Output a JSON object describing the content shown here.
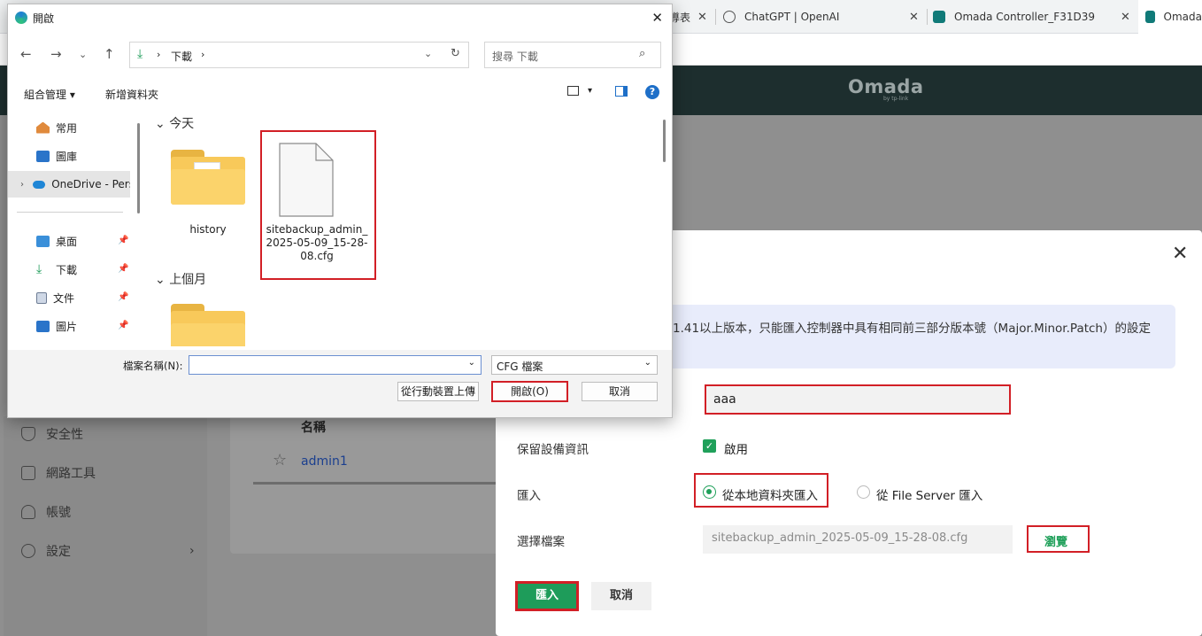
{
  "browser": {
    "tabs": [
      {
        "label": "導表",
        "favicon": "sheet-icon"
      },
      {
        "label": "ChatGPT | OpenAI",
        "favicon": "openai-icon"
      },
      {
        "label": "Omada Controller_F31D39",
        "favicon": "omada-icon"
      },
      {
        "label": "Omada",
        "favicon": "omada-icon"
      }
    ]
  },
  "omada": {
    "logo": "Omada",
    "logo_sub": "by tp-link",
    "nav": [
      {
        "label": "安全性",
        "icon": "shield-icon"
      },
      {
        "label": "網路工具",
        "icon": "toolbox-icon"
      },
      {
        "label": "帳號",
        "icon": "user-icon"
      },
      {
        "label": "設定",
        "icon": "gear-icon"
      }
    ],
    "table": {
      "header": "名稱",
      "rows": [
        "admin1"
      ]
    }
  },
  "import_modal": {
    "notice": "1.41以上版本，只能匯入控制器中具有相同前三部分版本號（Major.Minor.Patch）的設定",
    "name_value": "aaa",
    "keep_device_label": "保留設備資訊",
    "keep_device_option": "啟用",
    "import_label": "匯入",
    "radio_local": "從本地資料夾匯入",
    "radio_server": "從 File Server 匯入",
    "choose_file_label": "選擇檔案",
    "file_value": "sitebackup_admin_2025-05-09_15-28-08.cfg",
    "browse": "瀏覽",
    "import_button": "匯入",
    "cancel_button": "取消"
  },
  "open_dialog": {
    "title": "開啟",
    "path": [
      "下載"
    ],
    "search_placeholder": "搜尋 下載",
    "organize": "組合管理",
    "new_folder": "新增資料夾",
    "nav_items": [
      {
        "label": "常用",
        "icon": "home-icon"
      },
      {
        "label": "圖庫",
        "icon": "gallery-icon"
      },
      {
        "label": "OneDrive - Pers",
        "icon": "cloud-icon"
      },
      {
        "label": "桌面",
        "icon": "desktop-icon"
      },
      {
        "label": "下載",
        "icon": "download-icon"
      },
      {
        "label": "文件",
        "icon": "document-icon"
      },
      {
        "label": "圖片",
        "icon": "picture-icon"
      }
    ],
    "group_today": "今天",
    "group_last_month": "上個月",
    "files": [
      {
        "name": "history",
        "type": "folder"
      },
      {
        "name": "sitebackup_admin_2025-05-09_15-28-08.cfg",
        "type": "file"
      }
    ],
    "filename_label": "檔案名稱(N):",
    "filename_value": "",
    "filter": "CFG 檔案",
    "upload_button": "從行動裝置上傳",
    "open_button": "開啟(O)",
    "cancel_button": "取消"
  }
}
